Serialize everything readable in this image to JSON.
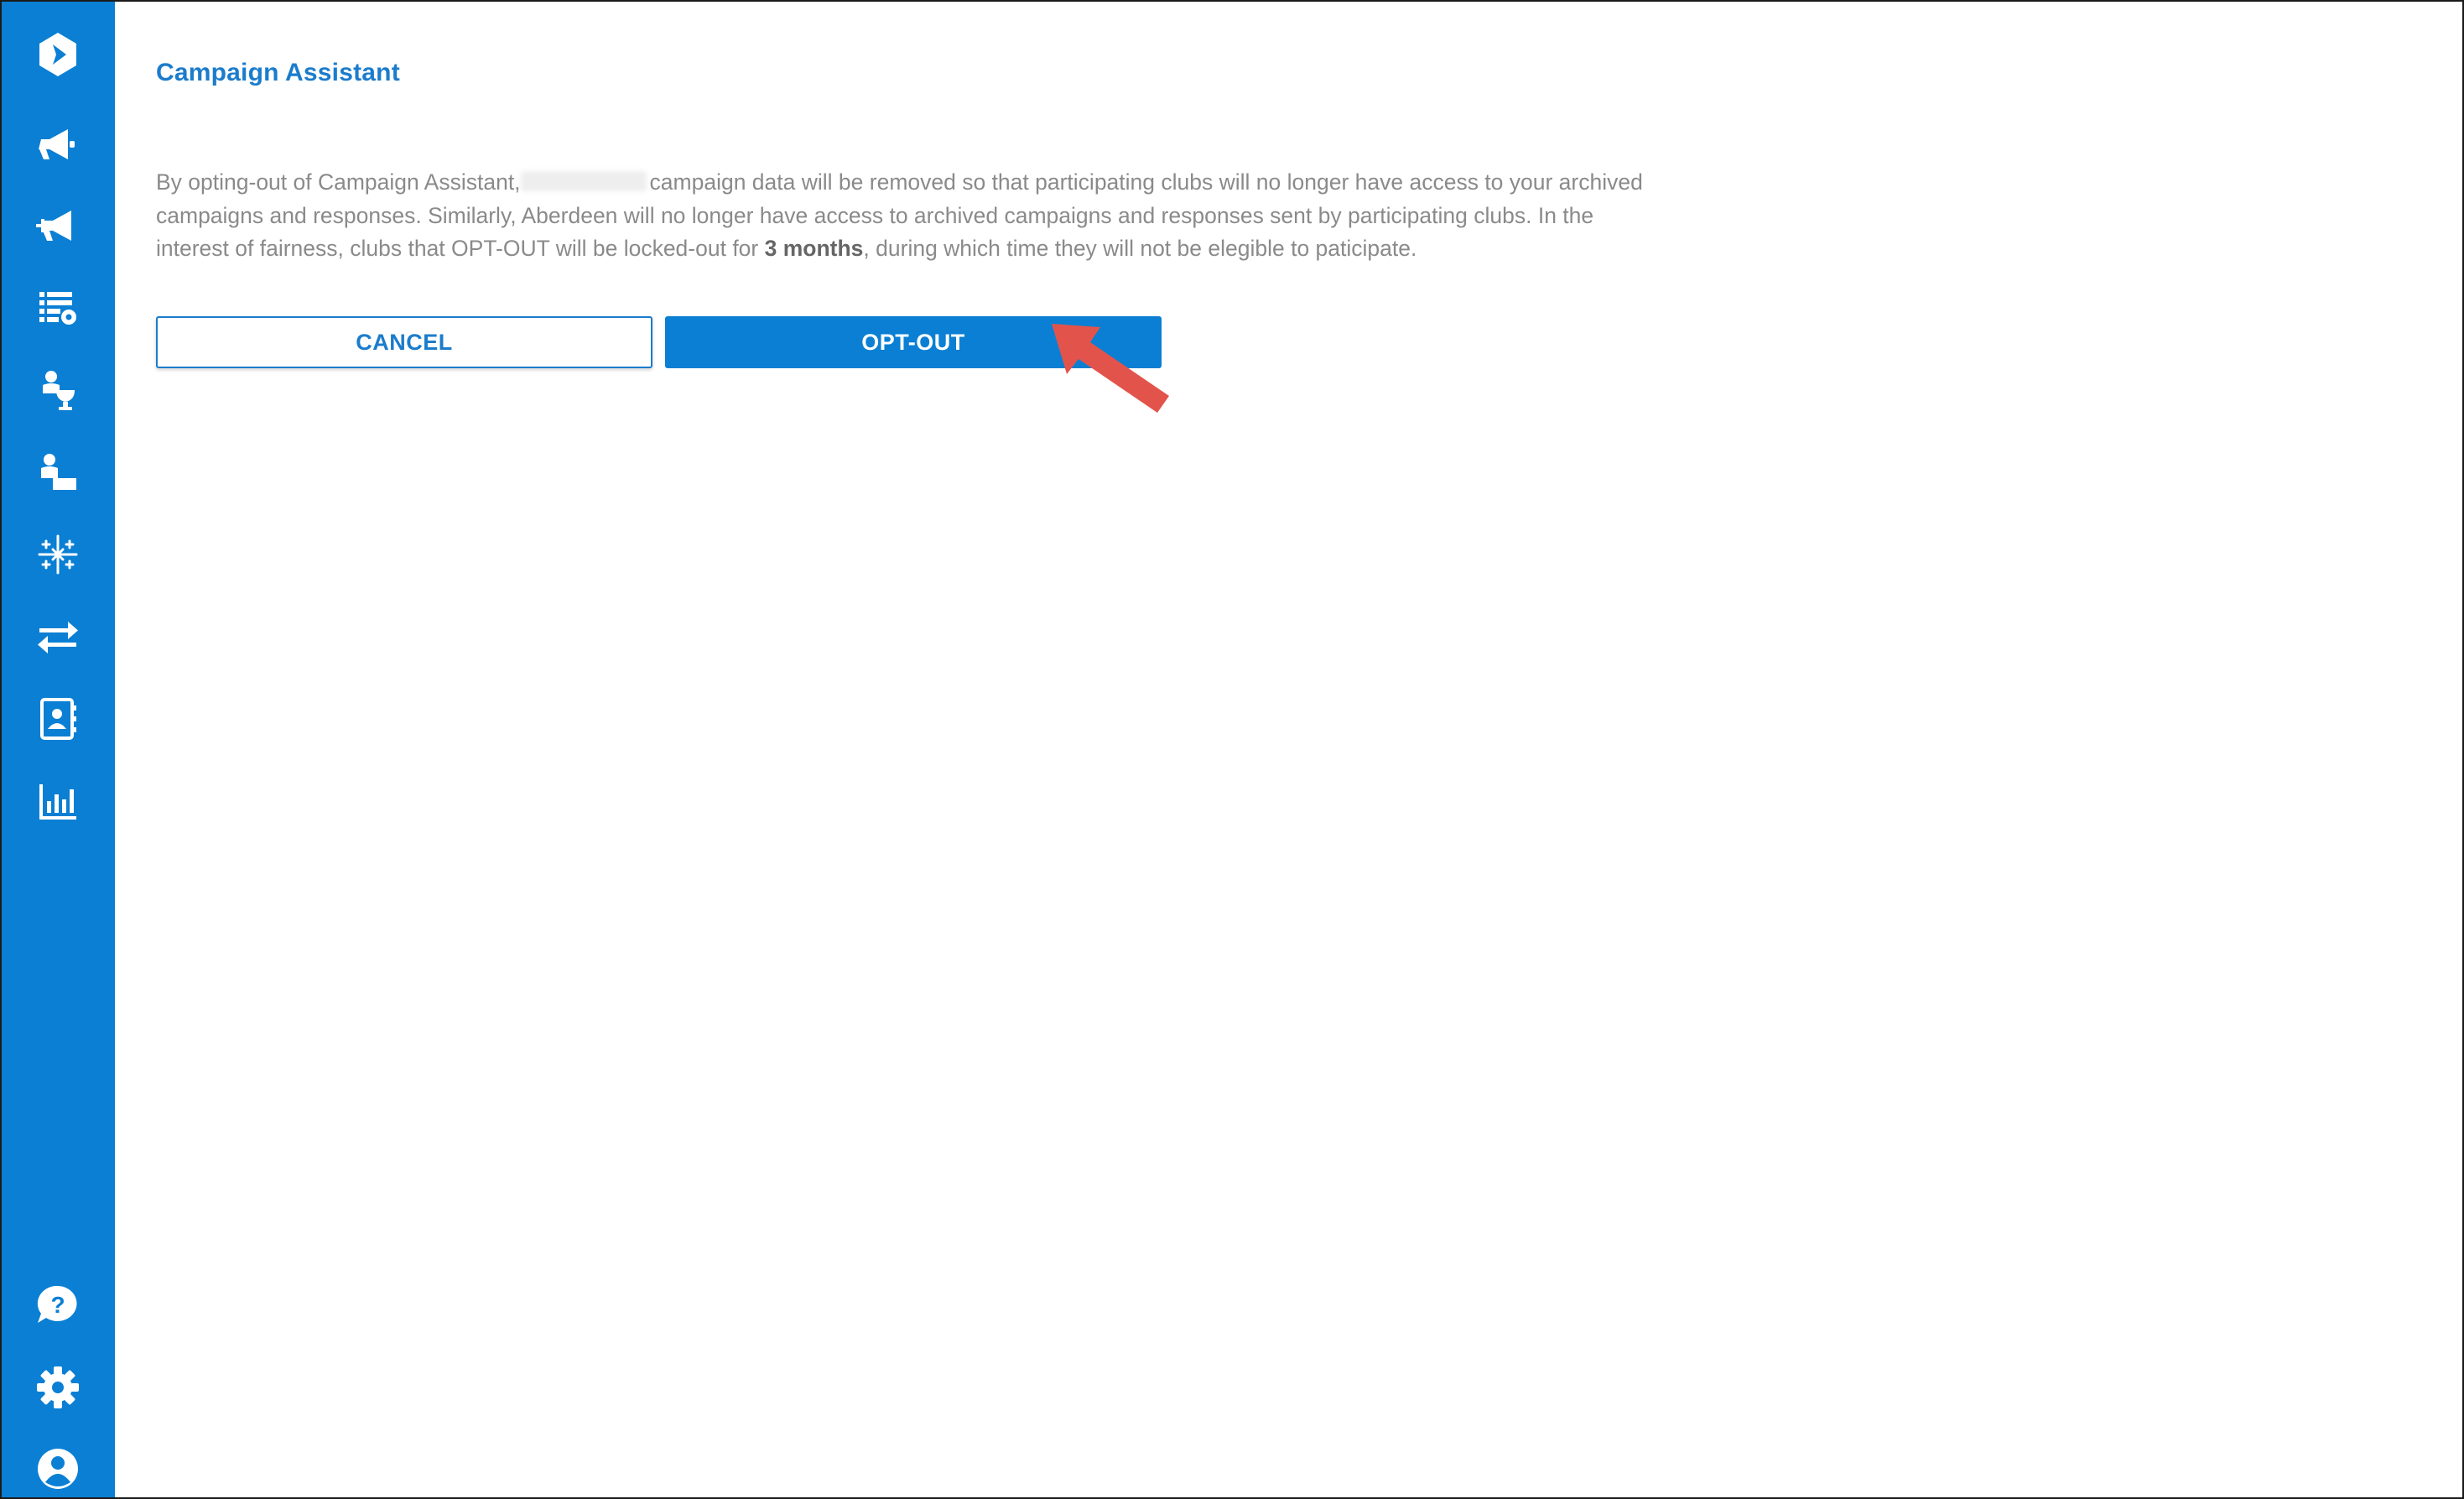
{
  "page": {
    "title": "Campaign Assistant",
    "description": {
      "part1": "By opting-out of Campaign Assistant,",
      "part2": "campaign data will be removed so that participating clubs will no longer have access to your archived campaigns and responses. Similarly, Aberdeen will no longer have access to archived campaigns and responses sent by participating clubs. In the interest of fairness, clubs that OPT-OUT will be locked-out for",
      "emphasis": "3 months",
      "part3": ", during which time they will not be elegible to paticipate."
    },
    "buttons": {
      "cancel_label": "CANCEL",
      "optout_label": "OPT-OUT"
    }
  },
  "sidebar": {
    "top_icons": [
      "logo-icon",
      "megaphone-icon",
      "megaphone-add-icon",
      "list-settings-icon",
      "person-trophy-icon",
      "person-desk-icon",
      "sparkle-grid-icon",
      "transfer-arrows-icon",
      "contact-book-icon",
      "bar-chart-icon"
    ],
    "bottom_icons": [
      "help-icon",
      "gear-icon",
      "account-icon"
    ]
  },
  "colors": {
    "sidebar": "#0a7fd4",
    "accent": "#1b7ccc",
    "annotation_arrow": "#e2544b"
  }
}
